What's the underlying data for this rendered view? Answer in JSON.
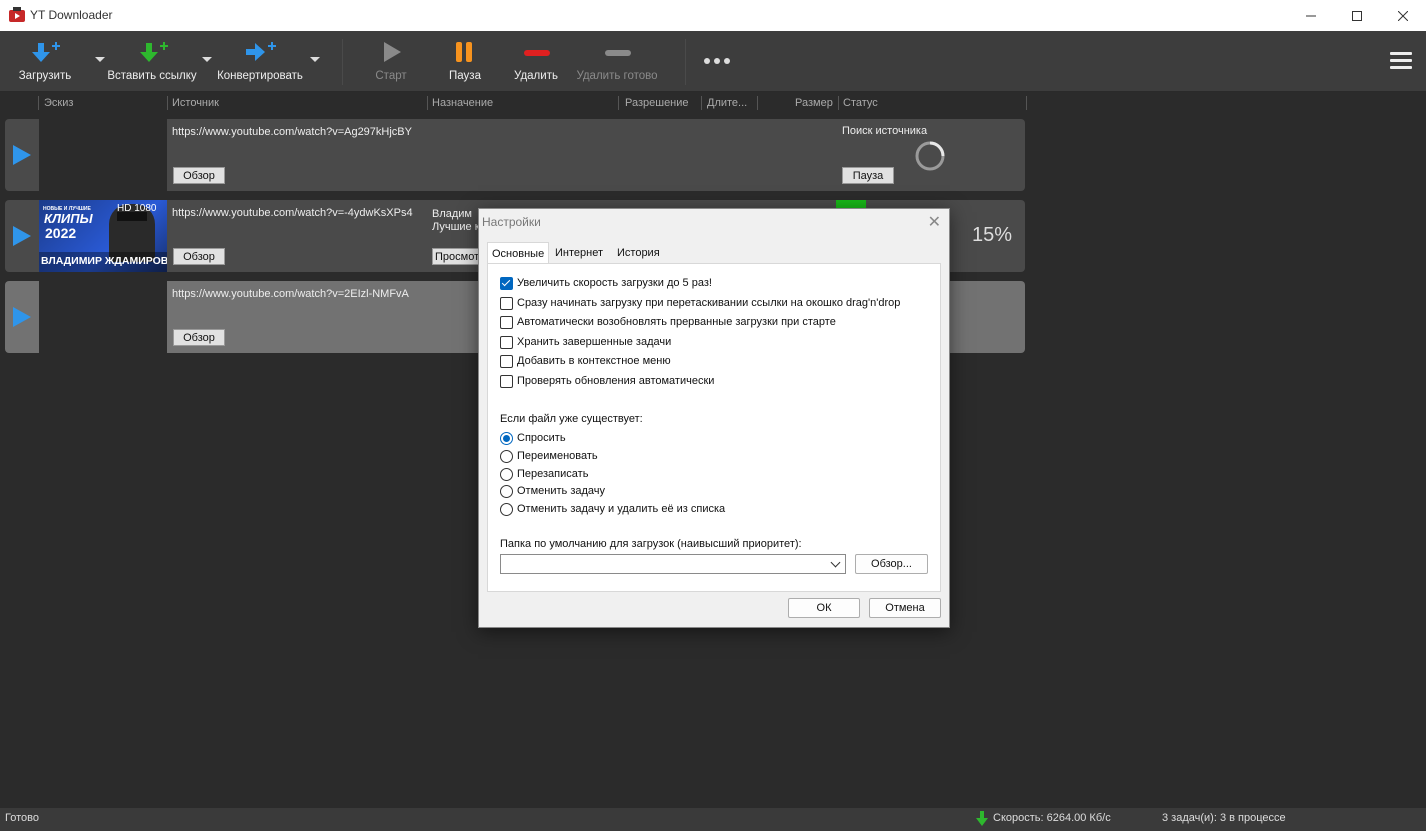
{
  "window": {
    "title": "YT Downloader"
  },
  "toolbar": {
    "download": "Загрузить",
    "paste_link": "Вставить ссылку",
    "convert": "Конвертировать",
    "start": "Старт",
    "pause": "Пауза",
    "delete": "Удалить",
    "delete_done": "Удалить готово"
  },
  "columns": [
    "Эскиз",
    "Источник",
    "Назначение",
    "Разрешение",
    "Длите...",
    "Размер",
    "Статус"
  ],
  "rows": [
    {
      "url": "https://www.youtube.com/watch?v=Ag297kHjcBY",
      "browse": "Обзор",
      "status": "Поиск источника",
      "action": "Пауза"
    },
    {
      "url": "https://www.youtube.com/watch?v=-4ydwKsXPs4",
      "browse": "Обзор",
      "dest1": "Владим",
      "dest2": "Лучшие к",
      "view": "Просмот",
      "percent": "15%",
      "thumb": {
        "hd": "HD 1080",
        "line1": "НОВЫЕ И ЛУЧШИЕ",
        "clips": "КЛИПЫ",
        "year": "2022",
        "name": "ВЛАДИМИР ЖДАМИРОВ"
      }
    },
    {
      "url": "https://www.youtube.com/watch?v=2EIzl-NMFvA",
      "browse": "Обзор"
    }
  ],
  "status_bar": {
    "left": "Готово",
    "speed": "Скорость: 6264.00 Кб/с",
    "tasks": "3 задач(и): 3 в процессе"
  },
  "dialog": {
    "title": "Настройки",
    "tabs": [
      "Основные",
      "Интернет",
      "История"
    ],
    "checkboxes": [
      {
        "label": "Увеличить скорость загрузки до 5 раз!",
        "checked": true
      },
      {
        "label": "Сразу начинать загрузку при перетаскивании ссылки на окошко drag'n'drop",
        "checked": false
      },
      {
        "label": "Автоматически возобновлять прерванные загрузки при старте",
        "checked": false
      },
      {
        "label": "Хранить завершенные задачи",
        "checked": false
      },
      {
        "label": "Добавить в контекстное меню",
        "checked": false
      },
      {
        "label": "Проверять обновления автоматически",
        "checked": false
      }
    ],
    "exists_label": "Если файл уже существует:",
    "radios": [
      {
        "label": "Спросить",
        "selected": true
      },
      {
        "label": "Переименовать",
        "selected": false
      },
      {
        "label": "Перезаписать",
        "selected": false
      },
      {
        "label": "Отменить задачу",
        "selected": false
      },
      {
        "label": "Отменить задачу и удалить её из списка",
        "selected": false
      }
    ],
    "folder_label": "Папка по умолчанию для загрузок (наивысший приоритет):",
    "folder_value": "",
    "browse": "Обзор...",
    "ok": "ОК",
    "cancel": "Отмена"
  }
}
